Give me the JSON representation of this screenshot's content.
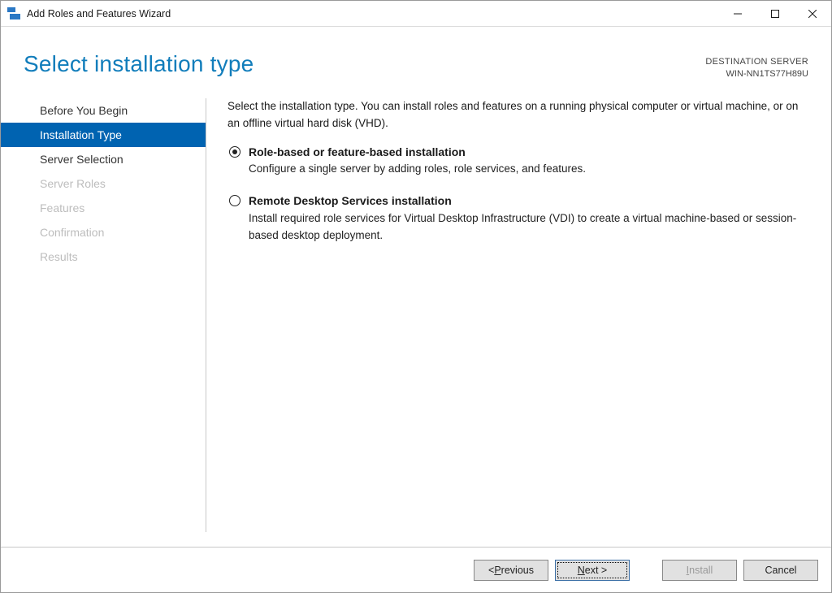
{
  "window": {
    "title": "Add Roles and Features Wizard"
  },
  "header": {
    "title": "Select installation type",
    "destination_label": "DESTINATION SERVER",
    "destination_server": "WIN-NN1TS77H89U"
  },
  "sidebar": {
    "steps": [
      {
        "label": "Before You Begin",
        "state": "prev"
      },
      {
        "label": "Installation Type",
        "state": "active"
      },
      {
        "label": "Server Selection",
        "state": "prev"
      },
      {
        "label": "Server Roles",
        "state": "disabled"
      },
      {
        "label": "Features",
        "state": "disabled"
      },
      {
        "label": "Confirmation",
        "state": "disabled"
      },
      {
        "label": "Results",
        "state": "disabled"
      }
    ]
  },
  "main": {
    "intro": "Select the installation type. You can install roles and features on a running physical computer or virtual machine, or on an offline virtual hard disk (VHD).",
    "options": [
      {
        "title": "Role-based or feature-based installation",
        "desc": "Configure a single server by adding roles, role services, and features.",
        "selected": true
      },
      {
        "title": "Remote Desktop Services installation",
        "desc": "Install required role services for Virtual Desktop Infrastructure (VDI) to create a virtual machine-based or session-based desktop deployment.",
        "selected": false
      }
    ]
  },
  "footer": {
    "previous_prefix": "< ",
    "previous_accel": "P",
    "previous_rest": "revious",
    "next_accel": "N",
    "next_rest": "ext >",
    "install_accel": "I",
    "install_rest": "nstall",
    "cancel": "Cancel",
    "install_enabled": false
  }
}
